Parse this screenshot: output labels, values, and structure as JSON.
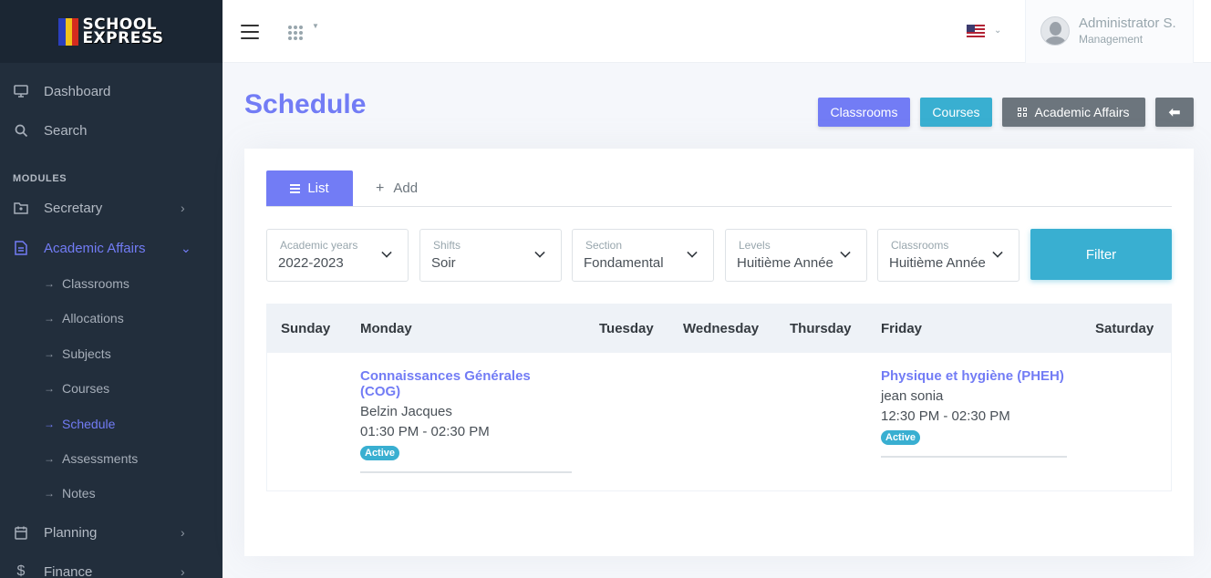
{
  "brand": {
    "line1": "SCHOOL",
    "line2": "EXPRESS"
  },
  "sidebar": {
    "dashboard": "Dashboard",
    "search": "Search",
    "modules_header": "MODULES",
    "secretary": "Secretary",
    "academic": "Academic Affairs",
    "sub": [
      "Classrooms",
      "Allocations",
      "Subjects",
      "Courses",
      "Schedule",
      "Assessments",
      "Notes"
    ],
    "planning": "Planning",
    "finance": "Finance"
  },
  "topbar": {
    "user_name": "Administrator S.",
    "user_role": "Management"
  },
  "page": {
    "title": "Schedule",
    "buttons": {
      "classrooms": "Classrooms",
      "courses": "Courses",
      "academic": "Academic Affairs"
    }
  },
  "tabs": {
    "list": "List",
    "add": "Add"
  },
  "filters": {
    "academic_years": {
      "label": "Academic years",
      "value": "2022-2023"
    },
    "shifts": {
      "label": "Shifts",
      "value": "Soir"
    },
    "section": {
      "label": "Section",
      "value": "Fondamental"
    },
    "levels": {
      "label": "Levels",
      "value": "Huitième Année"
    },
    "classrooms": {
      "label": "Classrooms",
      "value": "Huitième Année"
    },
    "filter_button": "Filter"
  },
  "schedule": {
    "days": [
      "Sunday",
      "Monday",
      "Tuesday",
      "Wednesday",
      "Thursday",
      "Friday",
      "Saturday"
    ],
    "entries": {
      "monday": {
        "course": "Connaissances Générales (COG)",
        "teacher": "Belzin Jacques",
        "time": "01:30 PM - 02:30 PM",
        "status": "Active"
      },
      "friday": {
        "course": "Physique et hygiène (PHEH)",
        "teacher": "jean sonia",
        "time": "12:30 PM - 02:30 PM",
        "status": "Active"
      }
    }
  },
  "colors": {
    "primary": "#727cf5",
    "info": "#39afd1",
    "secondary": "#6c757d",
    "sidebar": "#222e3c"
  }
}
